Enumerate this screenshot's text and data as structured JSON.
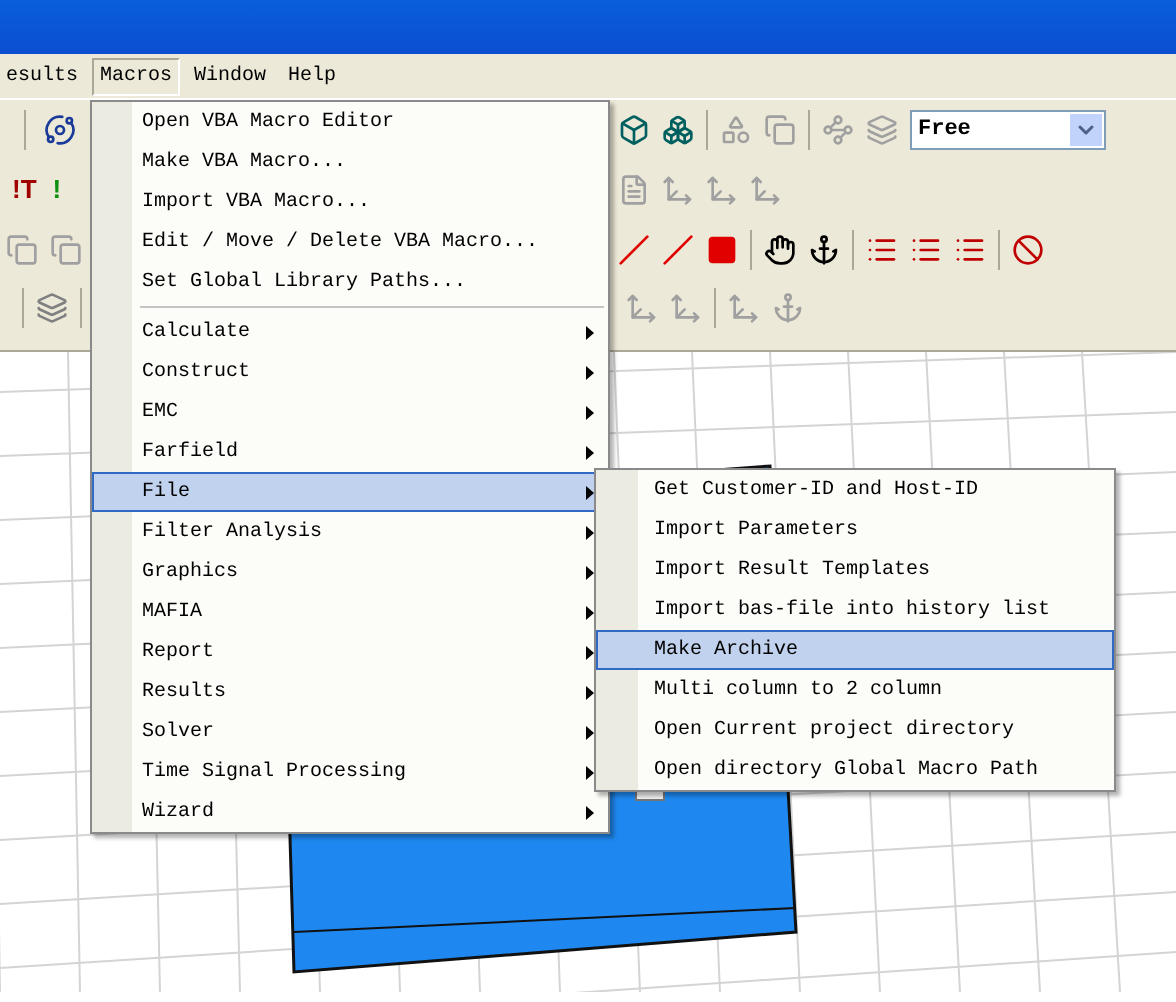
{
  "menubar": [
    {
      "label": "esults",
      "selected": false
    },
    {
      "label": "Macros",
      "selected": true
    },
    {
      "label": "Window",
      "selected": false
    },
    {
      "label": "Help",
      "selected": false
    }
  ],
  "toolbar": {
    "dropdown_value": "Free",
    "text_buttons": [
      {
        "label": "!T",
        "color": "#a00000"
      },
      {
        "label": "!",
        "color": "#109010"
      }
    ]
  },
  "macros_menu": [
    {
      "kind": "item",
      "label": "Open VBA Macro Editor",
      "selected": false
    },
    {
      "kind": "item",
      "label": "Make VBA Macro...",
      "selected": false
    },
    {
      "kind": "item",
      "label": "Import VBA Macro...",
      "selected": false
    },
    {
      "kind": "item",
      "label": "Edit / Move / Delete VBA Macro...",
      "selected": false
    },
    {
      "kind": "item",
      "label": "Set Global Library Paths...",
      "selected": false
    },
    {
      "kind": "separator"
    },
    {
      "kind": "submenu",
      "label": "Calculate",
      "selected": false
    },
    {
      "kind": "submenu",
      "label": "Construct",
      "selected": false
    },
    {
      "kind": "submenu",
      "label": "EMC",
      "selected": false
    },
    {
      "kind": "submenu",
      "label": "Farfield",
      "selected": false
    },
    {
      "kind": "submenu",
      "label": "File",
      "selected": true
    },
    {
      "kind": "submenu",
      "label": "Filter Analysis",
      "selected": false
    },
    {
      "kind": "submenu",
      "label": "Graphics",
      "selected": false
    },
    {
      "kind": "submenu",
      "label": "MAFIA",
      "selected": false
    },
    {
      "kind": "submenu",
      "label": "Report",
      "selected": false
    },
    {
      "kind": "submenu",
      "label": "Results",
      "selected": false
    },
    {
      "kind": "submenu",
      "label": "Solver",
      "selected": false
    },
    {
      "kind": "submenu",
      "label": "Time Signal Processing",
      "selected": false
    },
    {
      "kind": "submenu",
      "label": "Wizard",
      "selected": false
    }
  ],
  "file_submenu": [
    {
      "label": "Get Customer-ID and Host-ID",
      "selected": false
    },
    {
      "label": "Import Parameters",
      "selected": false
    },
    {
      "label": "Import Result Templates",
      "selected": false
    },
    {
      "label": "Import bas-file into history list",
      "selected": false
    },
    {
      "label": "Make Archive",
      "selected": true
    },
    {
      "label": "Multi column to 2 column",
      "selected": false
    },
    {
      "label": "Open Current project directory",
      "selected": false
    },
    {
      "label": "Open directory Global Macro Path",
      "selected": false
    }
  ]
}
